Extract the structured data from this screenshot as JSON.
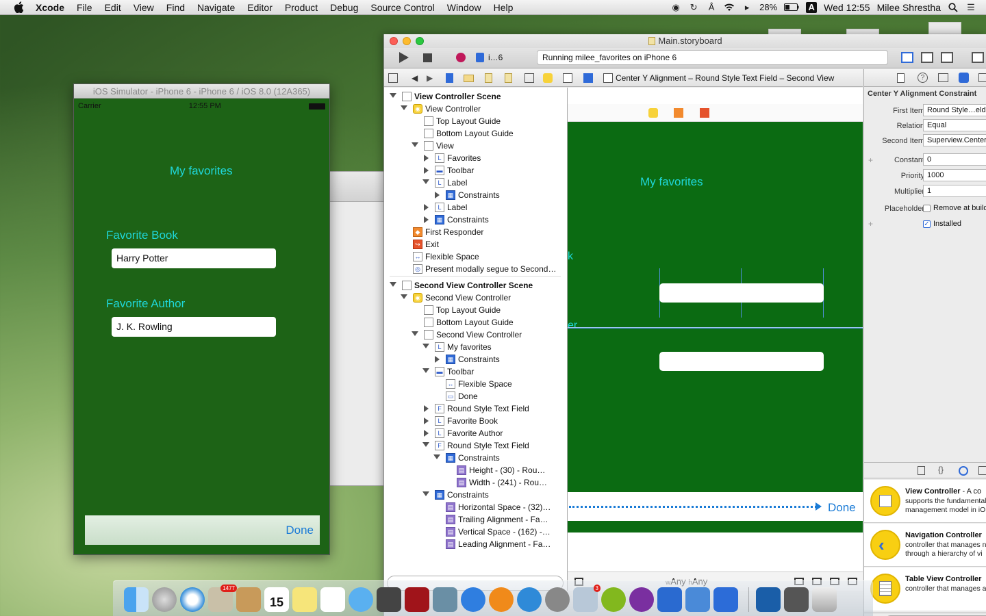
{
  "menubar": {
    "app": "Xcode",
    "items": [
      "File",
      "Edit",
      "View",
      "Find",
      "Navigate",
      "Editor",
      "Product",
      "Debug",
      "Source Control",
      "Window",
      "Help"
    ],
    "battery": "28%",
    "clock": "Wed 12:55",
    "user": "Milee Shrestha"
  },
  "simulator": {
    "title": "iOS Simulator - iPhone 6 - iPhone 6 / iOS 8.0 (12A365)",
    "carrier": "Carrier",
    "time": "12:55 PM",
    "heading": "My favorites",
    "book_label": "Favorite Book",
    "book_value": "Harry Potter",
    "author_label": "Favorite Author",
    "author_value": "J. K. Rowling",
    "done": "Done",
    "bg_color": "#1d6316",
    "label_color": "#1fd7d9"
  },
  "xcode": {
    "title": "Main.storyboard",
    "scheme": "i…6",
    "status": "Running milee_favorites on iPhone 6",
    "breadcrumb": "Center Y Alignment – Round Style Text Field – Second View Controller",
    "outline": [
      {
        "text": "View Controller Scene",
        "level": 0,
        "tri": "down",
        "icon": "",
        "scene": true
      },
      {
        "text": "View Controller",
        "level": 1,
        "tri": "down",
        "icon": "vc"
      },
      {
        "text": "Top Layout Guide",
        "level": 2,
        "tri": "",
        "icon": "box"
      },
      {
        "text": "Bottom Layout Guide",
        "level": 2,
        "tri": "",
        "icon": "box"
      },
      {
        "text": "View",
        "level": 2,
        "tri": "down",
        "icon": "box"
      },
      {
        "text": "Favorites",
        "level": 3,
        "tri": "right",
        "icon": "L"
      },
      {
        "text": "Toolbar",
        "level": 3,
        "tri": "right",
        "icon": "tb"
      },
      {
        "text": "Label",
        "level": 3,
        "tri": "down",
        "icon": "L"
      },
      {
        "text": "Constraints",
        "level": 4,
        "tri": "right",
        "icon": "con"
      },
      {
        "text": "Label",
        "level": 3,
        "tri": "right",
        "icon": "L"
      },
      {
        "text": "Constraints",
        "level": 3,
        "tri": "right",
        "icon": "con"
      },
      {
        "text": "First Responder",
        "level": 1,
        "tri": "",
        "icon": "fr"
      },
      {
        "text": "Exit",
        "level": 1,
        "tri": "",
        "icon": "ex"
      },
      {
        "text": "Flexible Space",
        "level": 1,
        "tri": "",
        "icon": "fs"
      },
      {
        "text": "Present modally segue to Second…",
        "level": 1,
        "tri": "",
        "icon": "seg"
      },
      {
        "text": "Second View Controller Scene",
        "level": 0,
        "tri": "down",
        "icon": "",
        "scene": true
      },
      {
        "text": "Second View Controller",
        "level": 1,
        "tri": "down",
        "icon": "vc"
      },
      {
        "text": "Top Layout Guide",
        "level": 2,
        "tri": "",
        "icon": "box"
      },
      {
        "text": "Bottom Layout Guide",
        "level": 2,
        "tri": "",
        "icon": "box"
      },
      {
        "text": "Second View Controller",
        "level": 2,
        "tri": "down",
        "icon": "box"
      },
      {
        "text": "My favorites",
        "level": 3,
        "tri": "down",
        "icon": "L"
      },
      {
        "text": "Constraints",
        "level": 4,
        "tri": "right",
        "icon": "con"
      },
      {
        "text": "Toolbar",
        "level": 3,
        "tri": "down",
        "icon": "tb"
      },
      {
        "text": "Flexible Space",
        "level": 4,
        "tri": "",
        "icon": "fs"
      },
      {
        "text": "Done",
        "level": 4,
        "tri": "",
        "icon": "item"
      },
      {
        "text": "Round Style Text Field",
        "level": 3,
        "tri": "right",
        "icon": "F"
      },
      {
        "text": "Favorite Book",
        "level": 3,
        "tri": "right",
        "icon": "L"
      },
      {
        "text": "Favorite Author",
        "level": 3,
        "tri": "right",
        "icon": "L"
      },
      {
        "text": "Round Style Text Field",
        "level": 3,
        "tri": "down",
        "icon": "F"
      },
      {
        "text": "Constraints",
        "level": 4,
        "tri": "down",
        "icon": "con"
      },
      {
        "text": "Height - (30) - Rou…",
        "level": 5,
        "tri": "",
        "icon": "cst"
      },
      {
        "text": "Width - (241) - Rou…",
        "level": 5,
        "tri": "",
        "icon": "cst"
      },
      {
        "text": "Constraints",
        "level": 3,
        "tri": "down",
        "icon": "con"
      },
      {
        "text": "Horizontal Space - (32)…",
        "level": 4,
        "tri": "",
        "icon": "cst"
      },
      {
        "text": "Trailing Alignment - Fa…",
        "level": 4,
        "tri": "",
        "icon": "cst"
      },
      {
        "text": "Vertical Space - (162) -…",
        "level": 4,
        "tri": "",
        "icon": "cst"
      },
      {
        "text": "Leading Alignment - Fa…",
        "level": 4,
        "tri": "",
        "icon": "cst"
      }
    ],
    "canvas": {
      "heading": "My favorites",
      "done": "Done",
      "size_w": "Any",
      "size_h": "Any",
      "partial_k": "k",
      "partial_er": "er"
    },
    "inspector": {
      "title": "Center Y Alignment Constraint",
      "first_item_label": "First Item",
      "first_item": "Round Style…eld",
      "relation_label": "Relation",
      "relation": "Equal",
      "second_item_label": "Second Item",
      "second_item": "Superview.Center",
      "constant_label": "Constant",
      "constant": "0",
      "priority_label": "Priority",
      "priority": "1000",
      "multiplier_label": "Multiplier",
      "multiplier": "1",
      "placeholder_label": "Placeholder",
      "placeholder_text": "Remove at build",
      "installed_text": "Installed"
    },
    "library": [
      {
        "title": "View Controller",
        "suffix": " - A co",
        "desc": "supports the fundamental\nmanagement model in iO"
      },
      {
        "title": "Navigation Controller",
        "suffix": "",
        "desc": "controller that manages n\nthrough a hierarchy of vi"
      },
      {
        "title": "Table View Controller",
        "suffix": "",
        "desc": "controller that manages a"
      }
    ]
  },
  "dock": {
    "mail_badge": "1477",
    "calendar_day": "15",
    "dock_badge_3": "3"
  }
}
